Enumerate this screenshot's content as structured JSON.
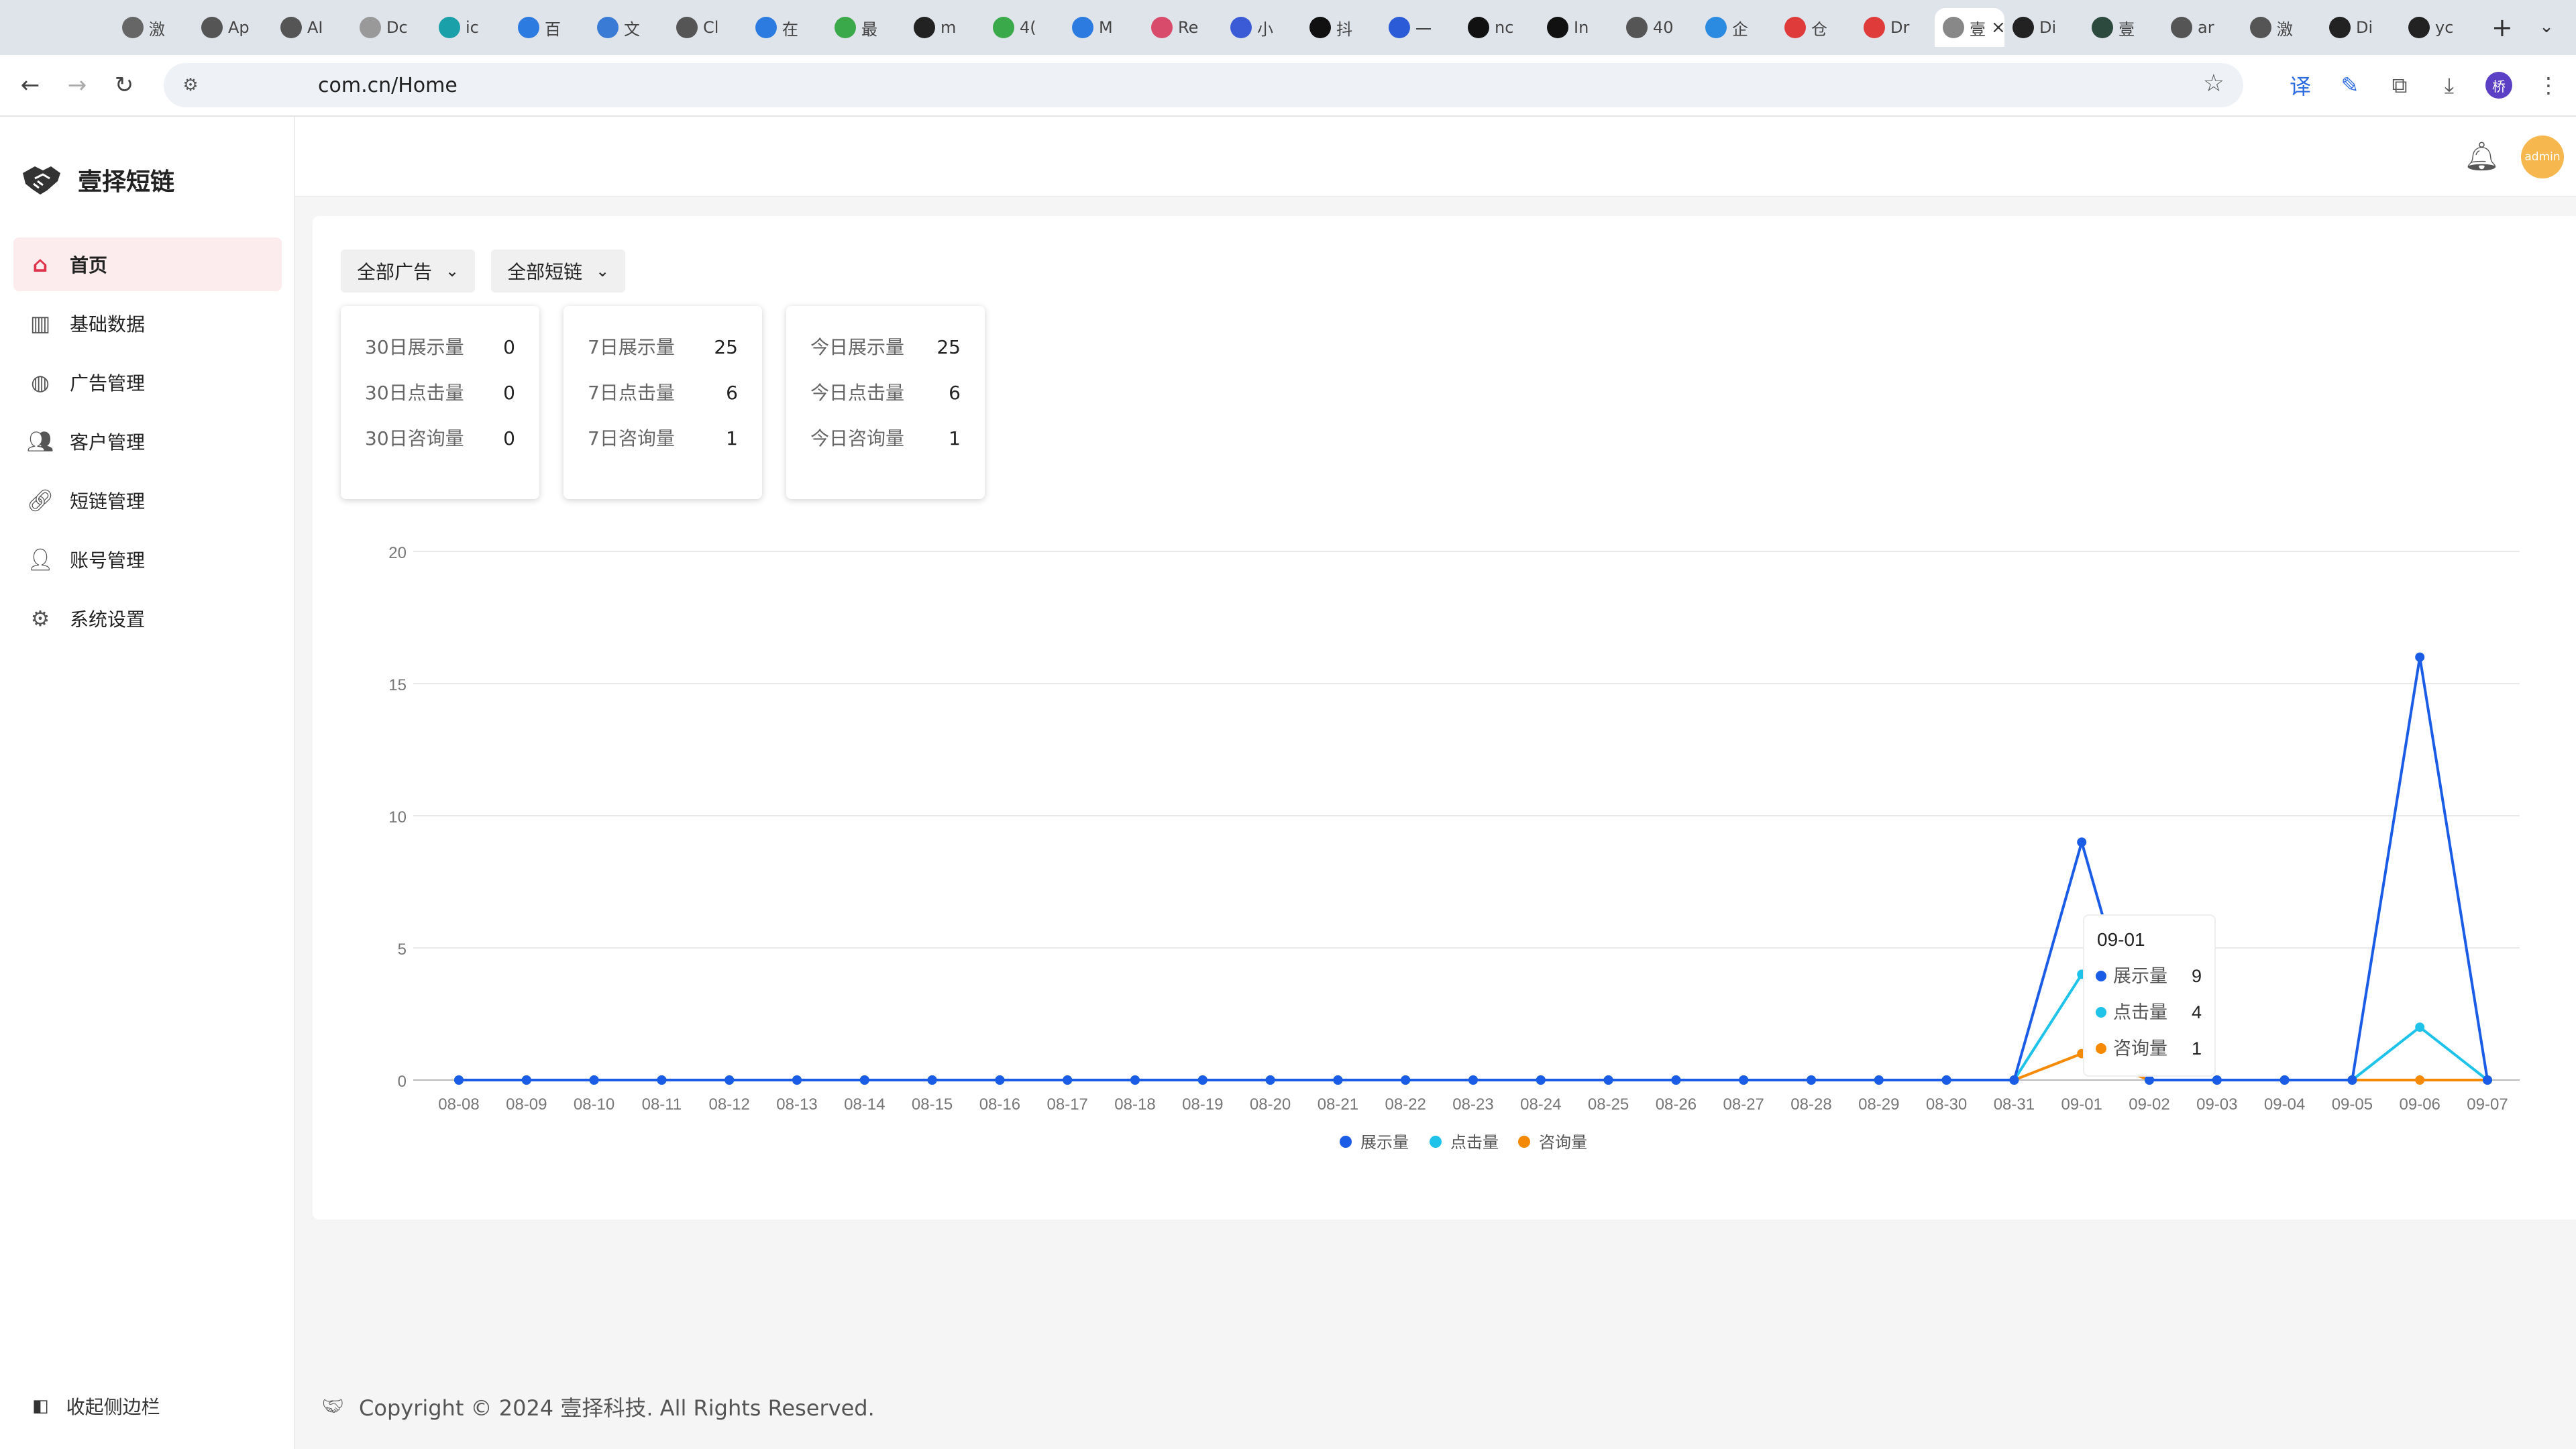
{
  "browser": {
    "tabs": [
      "激",
      "Ap",
      "AI",
      "Dc",
      "ic",
      "百",
      "文",
      "Cl",
      "在",
      "最",
      "m",
      "4(",
      "M",
      "Re",
      "小",
      "抖",
      "一",
      "nc",
      "In",
      "40",
      "企",
      "仓",
      "Dr",
      "壹",
      "Di",
      "壹",
      "ar",
      "激",
      "Di",
      "yc"
    ],
    "active_tab_index": 23,
    "url": "com.cn/Home",
    "profile_initial": "桥"
  },
  "app": {
    "brand_name": "壹择短链",
    "menu": [
      {
        "label": "首页",
        "icon": "home-icon"
      },
      {
        "label": "基础数据",
        "icon": "bar-chart-icon"
      },
      {
        "label": "广告管理",
        "icon": "github-icon"
      },
      {
        "label": "客户管理",
        "icon": "users-icon"
      },
      {
        "label": "短链管理",
        "icon": "link-icon"
      },
      {
        "label": "账号管理",
        "icon": "user-icon"
      },
      {
        "label": "系统设置",
        "icon": "gear-icon"
      }
    ],
    "active_menu_index": 0,
    "collapse_label": "收起侧边栏",
    "avatar_label": "admin"
  },
  "filters": {
    "ad": "全部广告",
    "shortlink": "全部短链"
  },
  "stats": [
    {
      "rows": [
        {
          "label": "30日展示量",
          "value": "0"
        },
        {
          "label": "30日点击量",
          "value": "0"
        },
        {
          "label": "30日咨询量",
          "value": "0"
        }
      ]
    },
    {
      "rows": [
        {
          "label": "7日展示量",
          "value": "25"
        },
        {
          "label": "7日点击量",
          "value": "6"
        },
        {
          "label": "7日咨询量",
          "value": "1"
        }
      ]
    },
    {
      "rows": [
        {
          "label": "今日展示量",
          "value": "25"
        },
        {
          "label": "今日点击量",
          "value": "6"
        },
        {
          "label": "今日咨询量",
          "value": "1"
        }
      ]
    }
  ],
  "chart_data": {
    "type": "line",
    "x": [
      "08-08",
      "08-09",
      "08-10",
      "08-11",
      "08-12",
      "08-13",
      "08-14",
      "08-15",
      "08-16",
      "08-17",
      "08-18",
      "08-19",
      "08-20",
      "08-21",
      "08-22",
      "08-23",
      "08-24",
      "08-25",
      "08-26",
      "08-27",
      "08-28",
      "08-29",
      "08-30",
      "08-31",
      "09-01",
      "09-02",
      "09-03",
      "09-04",
      "09-05",
      "09-06",
      "09-07"
    ],
    "series": [
      {
        "name": "展示量",
        "color": "#1a5ce6",
        "values": [
          0,
          0,
          0,
          0,
          0,
          0,
          0,
          0,
          0,
          0,
          0,
          0,
          0,
          0,
          0,
          0,
          0,
          0,
          0,
          0,
          0,
          0,
          0,
          0,
          9,
          0,
          0,
          0,
          0,
          16,
          0
        ]
      },
      {
        "name": "点击量",
        "color": "#1fc3ea",
        "values": [
          0,
          0,
          0,
          0,
          0,
          0,
          0,
          0,
          0,
          0,
          0,
          0,
          0,
          0,
          0,
          0,
          0,
          0,
          0,
          0,
          0,
          0,
          0,
          0,
          4,
          0,
          0,
          0,
          0,
          2,
          0
        ]
      },
      {
        "name": "咨询量",
        "color": "#f58a07",
        "values": [
          0,
          0,
          0,
          0,
          0,
          0,
          0,
          0,
          0,
          0,
          0,
          0,
          0,
          0,
          0,
          0,
          0,
          0,
          0,
          0,
          0,
          0,
          0,
          0,
          1,
          0,
          0,
          0,
          0,
          0,
          0
        ]
      }
    ],
    "ylim": [
      0,
      20
    ],
    "yticks": [
      0,
      5,
      10,
      15,
      20
    ],
    "legend_position": "bottom-center",
    "tooltip": {
      "title": "09-01",
      "rows": [
        {
          "name": "展示量",
          "value": "9"
        },
        {
          "name": "点击量",
          "value": "4"
        },
        {
          "name": "咨询量",
          "value": "1"
        }
      ]
    }
  },
  "footer": {
    "text": "Copyright © 2024 壹择科技. All Rights Reserved."
  }
}
